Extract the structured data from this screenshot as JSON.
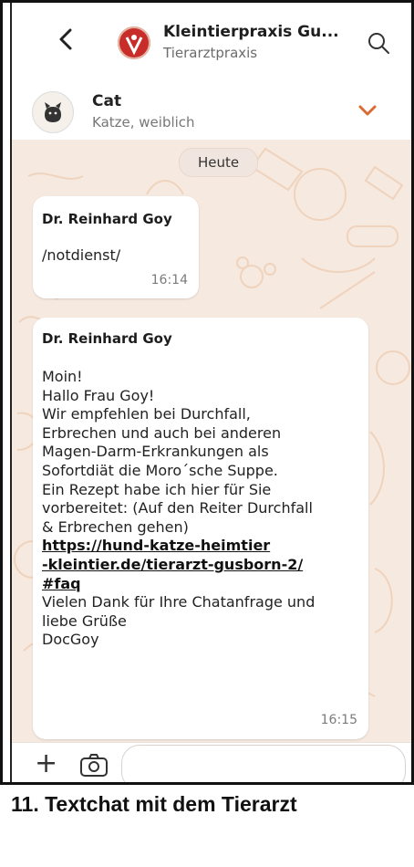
{
  "header": {
    "title": "Kleintierpraxis Gu...",
    "subtitle": "Tierarztpraxis"
  },
  "pet": {
    "name": "Cat",
    "details": "Katze, weiblich"
  },
  "chat": {
    "date_label": "Heute",
    "messages": [
      {
        "sender": "Dr. Reinhard Goy",
        "text": "/notdienst/",
        "time": "16:14"
      },
      {
        "sender": "Dr. Reinhard Goy",
        "lines": [
          "Moin!",
          "Hallo Frau Goy!",
          "Wir empfehlen bei Durchfall,",
          "Erbrechen und auch bei anderen",
          "Magen-Darm-Erkrankungen als",
          "Sofortdiät die Moro´sche Suppe.",
          "Ein Rezept habe ich hier für Sie",
          "vorbereitet: (Auf den Reiter Durchfall",
          "& Erbrechen gehen)"
        ],
        "link_lines": [
          "https://hund-katze-heimtier",
          "-kleintier.de/tierarzt-gusborn-2/",
          "#faq"
        ],
        "closing": [
          "Vielen Dank für Ihre Chatanfrage und",
          "liebe Grüße",
          "DocGoy"
        ],
        "time": "16:15"
      }
    ]
  },
  "composer": {
    "placeholder": ""
  },
  "caption": "11. Textchat mit dem Tierarzt",
  "colors": {
    "chat_background": "#f6e9df",
    "accent": "#d96b35"
  }
}
